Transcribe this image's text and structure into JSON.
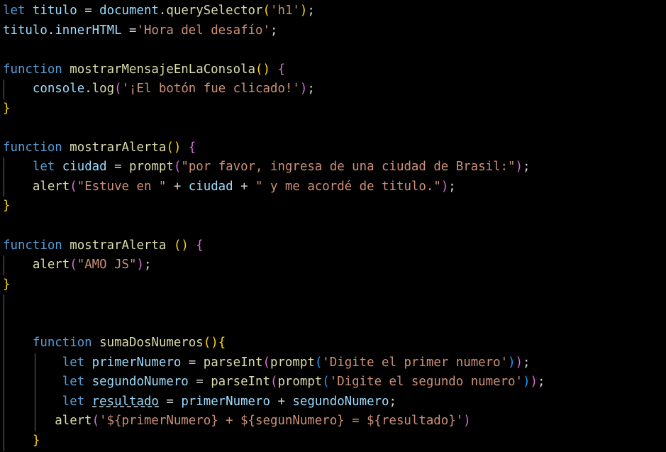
{
  "editor": {
    "language": "javascript",
    "background": "#000000",
    "default_text_color": "#d4d4d4",
    "font_size_px": 17,
    "colors": {
      "keyword": "#569cd6",
      "variable": "#9cdcfe",
      "function": "#dcdcaa",
      "string": "#ce9178",
      "operator": "#d4d4d4",
      "bracket_level_1": "#ffd700",
      "bracket_level_2": "#da70d6",
      "bracket_level_3": "#179fff",
      "indent_guide": "#6b6b6b",
      "warning_underline": "#9a9a9a"
    }
  },
  "code": {
    "l1": {
      "kw_let": "let",
      "var_titulo": " titulo ",
      "op_eq": "= ",
      "var_document": "document",
      "op_dot": ".",
      "fn_queryselector": "querySelector",
      "paren_open": "(",
      "str_h1": "'h1'",
      "paren_close": ")",
      "semi": ";"
    },
    "l2": {
      "var_titulo": "titulo",
      "op_dot": ".",
      "prop_innerhtml": "innerHTML",
      "op_eq": " =",
      "str_hora": "'Hora del desafío'",
      "semi": ";"
    },
    "l4": {
      "kw_function": "function",
      "fn_name": " mostrarMensajeEnLaConsola",
      "paren_open": "(",
      "paren_close": ")",
      "brace_open": " {"
    },
    "l5": {
      "var_console": "console",
      "op_dot": ".",
      "fn_log": "log",
      "paren_open": "(",
      "str_msg": "'¡El botón fue clicado!'",
      "paren_close": ")",
      "semi": ";"
    },
    "l6": {
      "brace_close": "}"
    },
    "l8": {
      "kw_function": "function",
      "fn_name": " mostrarAlerta",
      "paren_open": "(",
      "paren_close": ")",
      "brace_open": " {"
    },
    "l9": {
      "kw_let": "let",
      "var_ciudad": " ciudad ",
      "op_eq": "= ",
      "fn_prompt": "prompt",
      "paren_open": "(",
      "str_prompt": "\"por favor, ingresa de una ciudad de Brasil:\"",
      "paren_close": ")",
      "semi": ";"
    },
    "l10": {
      "fn_alert": "alert",
      "paren_open": "(",
      "str_a": "\"Estuve en \"",
      "op_plus1": " + ",
      "var_ciudad": "ciudad",
      "op_plus2": " + ",
      "str_b": "\" y me acordé de titulo.\"",
      "paren_close": ")",
      "semi": ";"
    },
    "l11": {
      "brace_close": "}"
    },
    "l13": {
      "kw_function": "function",
      "fn_name": " mostrarAlerta ",
      "paren_open": "(",
      "paren_close": ")",
      "brace_open": " {"
    },
    "l14": {
      "fn_alert": "alert",
      "paren_open": "(",
      "str_amo": "\"AMO JS\"",
      "paren_close": ")",
      "semi": ";"
    },
    "l15": {
      "brace_close": "}"
    },
    "l18": {
      "kw_function": "function",
      "fn_name": " sumaDosNumeros",
      "paren_open": "(",
      "paren_close": ")",
      "brace_open": "{"
    },
    "l19": {
      "kw_let": "let",
      "var_primer": " primerNumero ",
      "op_eq": "= ",
      "fn_parseint": "parseInt",
      "paren_open_1": "(",
      "fn_prompt": "prompt",
      "paren_open_2": "(",
      "str_digite": "'Digite el primer numero'",
      "paren_close_2": ")",
      "paren_close_1": ")",
      "semi": ";"
    },
    "l20": {
      "kw_let": "let",
      "var_segundo": " segundoNumero ",
      "op_eq": "= ",
      "fn_parseint": "parseInt",
      "paren_open_1": "(",
      "fn_prompt": "prompt",
      "paren_open_2": "(",
      "str_digite": "'Digite el segundo numero'",
      "paren_close_2": ")",
      "paren_close_1": ")",
      "semi": ";"
    },
    "l21": {
      "kw_let": "let",
      "space_a": " ",
      "var_resultado": "resultado",
      "op_eq": " = ",
      "var_primer": "primerNumero",
      "op_plus": " + ",
      "var_segundo": "segundoNumero",
      "semi": ";"
    },
    "l22": {
      "fn_alert": "alert",
      "paren_open": "(",
      "str_template": "'${primerNumero} + ${segunNumero} = ${resultado}'",
      "paren_close": ")"
    },
    "l23": {
      "brace_close": "}"
    }
  }
}
